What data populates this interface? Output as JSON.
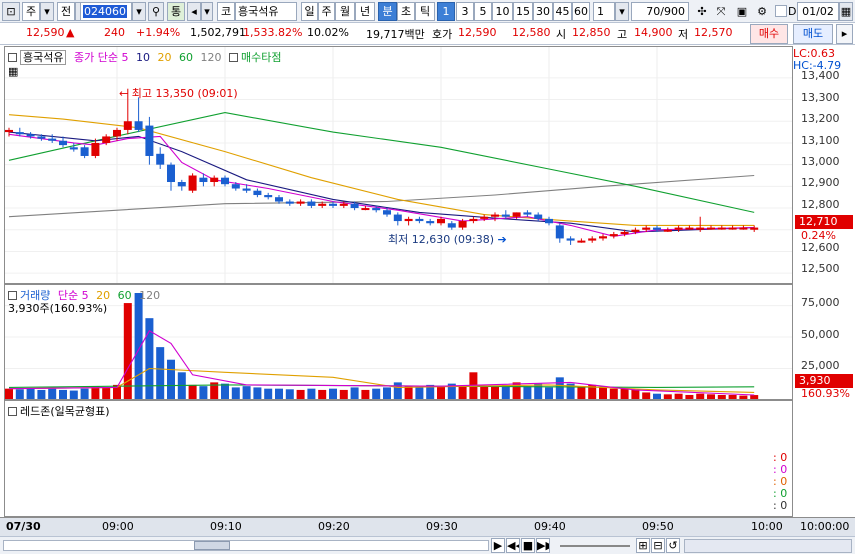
{
  "toolbar": {
    "type": "주",
    "mode": "전",
    "code": "024060",
    "tong": "통",
    "name_prefix": "코",
    "stock_name": "흥국석유",
    "periods": [
      "일",
      "주",
      "월",
      "년",
      "분",
      "초",
      "틱"
    ],
    "active_period": "분",
    "intervals": [
      "1",
      "3",
      "5",
      "10",
      "15",
      "30",
      "45",
      "60"
    ],
    "active_interval": "1",
    "count_select": "1",
    "count_display": "70/900",
    "date_flag": "D",
    "date": "01/02"
  },
  "quote": {
    "price": "12,590",
    "change": "240",
    "change_pct": "+1.94%",
    "volume": "1,502,791",
    "volume_pct": "1,533.82%",
    "turnover_pct": "10.02%",
    "amount": "19,717백만",
    "bidask_label": "호가",
    "ask": "12,590",
    "bid": "12,580",
    "open_label": "시",
    "open": "12,850",
    "high_label": "고",
    "high": "14,900",
    "low_label": "저",
    "low": "12,570",
    "buy_label": "매수",
    "sell_label": "매도"
  },
  "price_panel": {
    "legend": {
      "name": "흥국석유",
      "ma_label": "종가 단순",
      "ma_periods": [
        "5",
        "10",
        "20",
        "60",
        "120"
      ],
      "extra": "매수타점"
    },
    "lc": "LC:0.63",
    "hc": "HC:-4.79",
    "y_ticks": [
      "13,400",
      "13,300",
      "13,200",
      "13,100",
      "13,000",
      "12,900",
      "12,800",
      "12,700",
      "12,600",
      "12,500"
    ],
    "current_tag": "12,710",
    "current_pct": "0.24%",
    "high_note": "최고 13,350 (09:01)",
    "low_note": "최저 12,630 (09:38)"
  },
  "volume_panel": {
    "legend": {
      "name": "거래량",
      "ma_label": "단순",
      "ma_periods": [
        "5",
        "20",
        "60",
        "120"
      ]
    },
    "last": "3,930주(160.93%)",
    "y_ticks": [
      "75,000",
      "50,000",
      "25,000"
    ],
    "current_tag": "3,930",
    "current_pct": "160.93%"
  },
  "redzone_panel": {
    "title": "레드존(일목균형표)",
    "values": [
      ": 0",
      ": 0",
      ": 0",
      ": 0",
      ": 0"
    ]
  },
  "x_axis": {
    "date": "07/30",
    "labels": [
      "09:00",
      "09:10",
      "09:20",
      "09:30",
      "09:40",
      "09:50",
      "10:00"
    ],
    "end_time": "10:00:00"
  },
  "colors": {
    "up": "#e00000",
    "down": "#1a5fd0",
    "ma5": "#d000d0",
    "ma10": "#1a1a80",
    "ma20": "#e0a000",
    "ma60": "#10a030",
    "ma120": "#808080"
  },
  "chart_data": {
    "type": "candlestick",
    "interval": "1 minute",
    "x_start": "09:00",
    "price_ylim": [
      12450,
      13450
    ],
    "volume_ylim": [
      0,
      85000
    ],
    "candles": [
      {
        "o": 13150,
        "h": 13170,
        "l": 13130,
        "c": 13160
      },
      {
        "o": 13150,
        "h": 13170,
        "l": 13130,
        "c": 13140
      },
      {
        "o": 13140,
        "h": 13150,
        "l": 13120,
        "c": 13130
      },
      {
        "o": 13130,
        "h": 13140,
        "l": 13110,
        "c": 13120
      },
      {
        "o": 13120,
        "h": 13140,
        "l": 13100,
        "c": 13110
      },
      {
        "o": 13110,
        "h": 13130,
        "l": 13080,
        "c": 13090
      },
      {
        "o": 13080,
        "h": 13100,
        "l": 13060,
        "c": 13070
      },
      {
        "o": 13080,
        "h": 13090,
        "l": 13030,
        "c": 13040
      },
      {
        "o": 13040,
        "h": 13120,
        "l": 13030,
        "c": 13100
      },
      {
        "o": 13100,
        "h": 13140,
        "l": 13090,
        "c": 13130
      },
      {
        "o": 13130,
        "h": 13170,
        "l": 13110,
        "c": 13160
      },
      {
        "o": 13160,
        "h": 13350,
        "l": 13140,
        "c": 13200
      },
      {
        "o": 13200,
        "h": 13310,
        "l": 13150,
        "c": 13160
      },
      {
        "o": 13180,
        "h": 13220,
        "l": 13000,
        "c": 13040
      },
      {
        "o": 13050,
        "h": 13080,
        "l": 12980,
        "c": 13000
      },
      {
        "o": 13000,
        "h": 13010,
        "l": 12880,
        "c": 12920
      },
      {
        "o": 12920,
        "h": 12930,
        "l": 12880,
        "c": 12900
      },
      {
        "o": 12880,
        "h": 12960,
        "l": 12870,
        "c": 12950
      },
      {
        "o": 12940,
        "h": 12960,
        "l": 12900,
        "c": 12920
      },
      {
        "o": 12920,
        "h": 12950,
        "l": 12900,
        "c": 12940
      },
      {
        "o": 12940,
        "h": 12950,
        "l": 12900,
        "c": 12910
      },
      {
        "o": 12910,
        "h": 12920,
        "l": 12880,
        "c": 12890
      },
      {
        "o": 12890,
        "h": 12910,
        "l": 12870,
        "c": 12880
      },
      {
        "o": 12880,
        "h": 12890,
        "l": 12850,
        "c": 12860
      },
      {
        "o": 12860,
        "h": 12870,
        "l": 12840,
        "c": 12850
      },
      {
        "o": 12850,
        "h": 12860,
        "l": 12820,
        "c": 12830
      },
      {
        "o": 12830,
        "h": 12840,
        "l": 12810,
        "c": 12820
      },
      {
        "o": 12820,
        "h": 12840,
        "l": 12810,
        "c": 12830
      },
      {
        "o": 12830,
        "h": 12840,
        "l": 12800,
        "c": 12810
      },
      {
        "o": 12810,
        "h": 12830,
        "l": 12800,
        "c": 12820
      },
      {
        "o": 12820,
        "h": 12830,
        "l": 12800,
        "c": 12810
      },
      {
        "o": 12810,
        "h": 12830,
        "l": 12800,
        "c": 12820
      },
      {
        "o": 12820,
        "h": 12830,
        "l": 12790,
        "c": 12800
      },
      {
        "o": 12800,
        "h": 12810,
        "l": 12790,
        "c": 12800
      },
      {
        "o": 12800,
        "h": 12810,
        "l": 12780,
        "c": 12790
      },
      {
        "o": 12790,
        "h": 12800,
        "l": 12760,
        "c": 12770
      },
      {
        "o": 12770,
        "h": 12780,
        "l": 12720,
        "c": 12740
      },
      {
        "o": 12740,
        "h": 12760,
        "l": 12720,
        "c": 12750
      },
      {
        "o": 12750,
        "h": 12760,
        "l": 12730,
        "c": 12740
      },
      {
        "o": 12740,
        "h": 12750,
        "l": 12720,
        "c": 12730
      },
      {
        "o": 12730,
        "h": 12760,
        "l": 12720,
        "c": 12750
      },
      {
        "o": 12730,
        "h": 12740,
        "l": 12700,
        "c": 12710
      },
      {
        "o": 12710,
        "h": 12750,
        "l": 12700,
        "c": 12740
      },
      {
        "o": 12740,
        "h": 12760,
        "l": 12730,
        "c": 12750
      },
      {
        "o": 12750,
        "h": 12770,
        "l": 12740,
        "c": 12760
      },
      {
        "o": 12760,
        "h": 12780,
        "l": 12740,
        "c": 12770
      },
      {
        "o": 12770,
        "h": 12790,
        "l": 12750,
        "c": 12760
      },
      {
        "o": 12760,
        "h": 12780,
        "l": 12750,
        "c": 12780
      },
      {
        "o": 12780,
        "h": 12790,
        "l": 12760,
        "c": 12770
      },
      {
        "o": 12770,
        "h": 12780,
        "l": 12740,
        "c": 12750
      },
      {
        "o": 12750,
        "h": 12760,
        "l": 12720,
        "c": 12730
      },
      {
        "o": 12720,
        "h": 12730,
        "l": 12640,
        "c": 12660
      },
      {
        "o": 12660,
        "h": 12670,
        "l": 12630,
        "c": 12650
      },
      {
        "o": 12650,
        "h": 12660,
        "l": 12640,
        "c": 12650
      },
      {
        "o": 12650,
        "h": 12670,
        "l": 12640,
        "c": 12660
      },
      {
        "o": 12660,
        "h": 12680,
        "l": 12650,
        "c": 12670
      },
      {
        "o": 12670,
        "h": 12690,
        "l": 12660,
        "c": 12680
      },
      {
        "o": 12680,
        "h": 12700,
        "l": 12670,
        "c": 12690
      },
      {
        "o": 12690,
        "h": 12710,
        "l": 12680,
        "c": 12700
      },
      {
        "o": 12700,
        "h": 12720,
        "l": 12690,
        "c": 12710
      },
      {
        "o": 12710,
        "h": 12720,
        "l": 12690,
        "c": 12700
      },
      {
        "o": 12700,
        "h": 12710,
        "l": 12690,
        "c": 12700
      },
      {
        "o": 12700,
        "h": 12720,
        "l": 12690,
        "c": 12710
      },
      {
        "o": 12710,
        "h": 12720,
        "l": 12700,
        "c": 12710
      },
      {
        "o": 12700,
        "h": 12760,
        "l": 12690,
        "c": 12710
      },
      {
        "o": 12710,
        "h": 12720,
        "l": 12700,
        "c": 12710
      },
      {
        "o": 12710,
        "h": 12720,
        "l": 12700,
        "c": 12710
      },
      {
        "o": 12710,
        "h": 12720,
        "l": 12700,
        "c": 12710
      },
      {
        "o": 12710,
        "h": 12720,
        "l": 12700,
        "c": 12710
      },
      {
        "o": 12700,
        "h": 12720,
        "l": 12690,
        "c": 12710
      }
    ],
    "volumes": [
      9000,
      8500,
      9000,
      8000,
      9000,
      8000,
      7500,
      9000,
      11000,
      10000,
      12000,
      77000,
      85000,
      65000,
      42000,
      32000,
      22000,
      12000,
      11000,
      14000,
      13000,
      10000,
      11000,
      10000,
      9000,
      9000,
      8500,
      8000,
      9000,
      8000,
      9000,
      8000,
      10000,
      8000,
      9000,
      10000,
      14000,
      11000,
      10000,
      12000,
      11000,
      13000,
      11000,
      22000,
      11000,
      11000,
      12000,
      14000,
      11000,
      13000,
      10000,
      18000,
      13000,
      11000,
      12000,
      10000,
      9000,
      9000,
      8000,
      6000,
      5000,
      4500,
      5000,
      4000,
      5000,
      4500,
      4000,
      4000,
      3500,
      3930
    ],
    "ma_lines": {
      "ma5": [
        [
          0,
          13140
        ],
        [
          6,
          13100
        ],
        [
          8,
          13090
        ],
        [
          11,
          13120
        ],
        [
          14,
          13130
        ],
        [
          16,
          13010
        ],
        [
          19,
          12930
        ],
        [
          24,
          12890
        ],
        [
          30,
          12830
        ],
        [
          36,
          12790
        ],
        [
          42,
          12740
        ],
        [
          48,
          12760
        ],
        [
          52,
          12720
        ],
        [
          56,
          12670
        ],
        [
          60,
          12700
        ],
        [
          69,
          12710
        ]
      ],
      "ma10": [
        [
          0,
          13150
        ],
        [
          8,
          13110
        ],
        [
          12,
          13130
        ],
        [
          16,
          13060
        ],
        [
          22,
          12930
        ],
        [
          30,
          12840
        ],
        [
          38,
          12780
        ],
        [
          46,
          12750
        ],
        [
          52,
          12730
        ],
        [
          58,
          12690
        ],
        [
          69,
          12710
        ]
      ],
      "ma20": [
        [
          0,
          13230
        ],
        [
          5,
          13210
        ],
        [
          12,
          13170
        ],
        [
          20,
          13060
        ],
        [
          28,
          12940
        ],
        [
          36,
          12840
        ],
        [
          44,
          12770
        ],
        [
          52,
          12740
        ],
        [
          58,
          12720
        ],
        [
          69,
          12720
        ]
      ],
      "ma60": [
        [
          0,
          13020
        ],
        [
          8,
          13110
        ],
        [
          20,
          13240
        ],
        [
          30,
          13150
        ],
        [
          40,
          13080
        ],
        [
          50,
          12980
        ],
        [
          58,
          12900
        ],
        [
          69,
          12780
        ]
      ],
      "ma120": [
        [
          0,
          12760
        ],
        [
          20,
          12820
        ],
        [
          35,
          12830
        ],
        [
          45,
          12860
        ],
        [
          55,
          12900
        ],
        [
          69,
          12950
        ]
      ],
      "vol5": [
        [
          0,
          9000
        ],
        [
          10,
          10000
        ],
        [
          11,
          25000
        ],
        [
          13,
          55000
        ],
        [
          15,
          45000
        ],
        [
          17,
          20000
        ],
        [
          22,
          12000
        ],
        [
          40,
          11000
        ],
        [
          52,
          14000
        ],
        [
          58,
          8000
        ],
        [
          69,
          4000
        ]
      ],
      "vol20": [
        [
          0,
          9000
        ],
        [
          10,
          10000
        ],
        [
          13,
          25000
        ],
        [
          20,
          22000
        ],
        [
          30,
          18000
        ],
        [
          36,
          10000
        ],
        [
          50,
          12000
        ],
        [
          60,
          8000
        ],
        [
          69,
          6000
        ]
      ],
      "vol60": [
        [
          0,
          10000
        ],
        [
          20,
          12000
        ],
        [
          40,
          11000
        ],
        [
          60,
          10000
        ],
        [
          69,
          10500
        ]
      ]
    }
  }
}
